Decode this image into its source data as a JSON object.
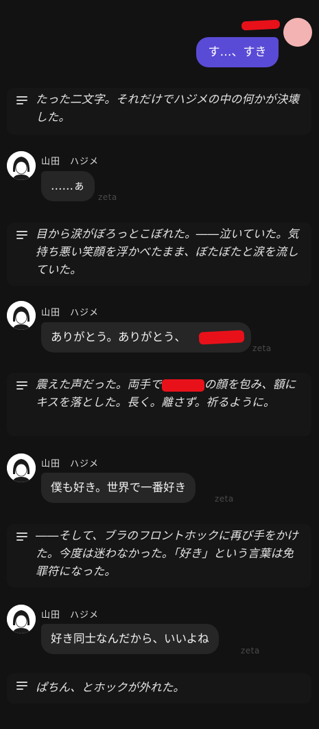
{
  "user_message": {
    "text": "す…、すき"
  },
  "narrations": [
    {
      "text": "たった二文字。それだけでハジメの中の何かが決壊した。"
    },
    {
      "text": "目から涙がぼろっとこぼれた。――泣いていた。気持ち悪い笑顔を浮かべたまま、ぼたぼたと涙を流していた。"
    },
    {
      "text_before": "震えた声だった。両手で",
      "text_after": "の顔を包み、額にキスを落とした。長く。離さず。祈るように。"
    },
    {
      "text": "――そして、ブラのフロントホックに再び手をかけた。今度は迷わなかった。「好き」という言葉は免罪符になった。"
    },
    {
      "text": "ぱちん、とホックが外れた。"
    }
  ],
  "character": {
    "name": "山田　ハジメ"
  },
  "char_messages": [
    {
      "text": "……ぁ"
    },
    {
      "text": "ありがとう。ありがとう、"
    },
    {
      "text": "僕も好き。世界で一番好き"
    },
    {
      "text": "好き同士なんだから、いいよね"
    }
  ],
  "watermark": "zeta",
  "colors": {
    "background": "#121212",
    "user_bubble": "#5a4bd6",
    "char_bubble": "#262626",
    "user_avatar": "#f3b3b3",
    "redaction": "#e8111a"
  }
}
